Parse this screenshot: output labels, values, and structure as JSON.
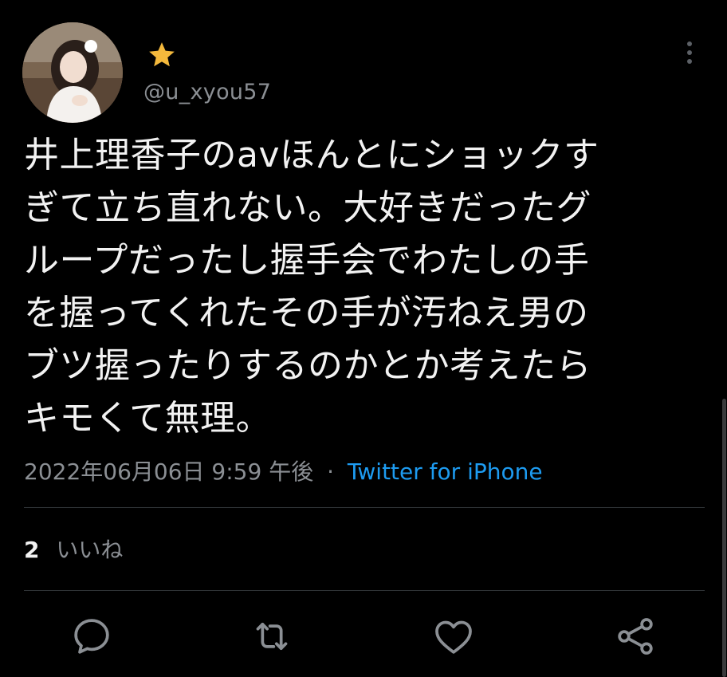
{
  "tweet": {
    "handle": "@u_xyou57",
    "text_lines": [
      "井上理香子のavほんとにショックす",
      "ぎて立ち直れない。大好きだったグ",
      "ループだったし握手会でわたしの手",
      "を握ってくれたその手が汚ねえ男の",
      "ブツ握ったりするのかとか考えたら",
      "キモくて無理。"
    ],
    "timestamp": "2022年06月06日 9:59 午後",
    "separator": "·",
    "source": "Twitter for iPhone",
    "likes_count": "2",
    "likes_label": "いいね"
  },
  "icons": {
    "badge": "star-icon",
    "more": "more-vertical-icon",
    "reply": "reply-icon",
    "retweet": "retweet-icon",
    "like": "heart-icon",
    "share": "share-icon"
  },
  "colors": {
    "background": "#000000",
    "text": "#f2f2f2",
    "muted": "#8b8f94",
    "link": "#1d9bf0",
    "star": "#f4b93c",
    "divider": "#2f3336"
  }
}
